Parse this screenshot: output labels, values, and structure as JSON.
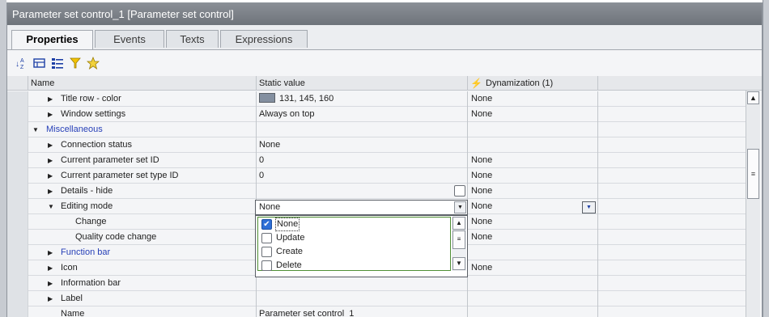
{
  "window": {
    "title": "Parameter set control_1 [Parameter set control]"
  },
  "tabs": [
    {
      "label": "Properties",
      "active": true
    },
    {
      "label": "Events",
      "active": false
    },
    {
      "label": "Texts",
      "active": false
    },
    {
      "label": "Expressions",
      "active": false
    }
  ],
  "toolbar": {
    "icons": [
      "sort-icon",
      "category-icon",
      "list-icon",
      "filter-icon",
      "favorites-icon"
    ]
  },
  "grid": {
    "headers": {
      "name": "Name",
      "static": "Static value",
      "dynamization": "Dynamization (1)"
    },
    "rows": [
      {
        "name": "Title row - color",
        "static": "131, 145, 160",
        "dyn": "None"
      },
      {
        "name": "Window settings",
        "static": "Always on top",
        "dyn": "None"
      },
      {
        "name": "Miscellaneous",
        "static": "",
        "dyn": ""
      },
      {
        "name": "Connection status",
        "static": "None",
        "dyn": ""
      },
      {
        "name": "Current parameter set ID",
        "static": "0",
        "dyn": "None"
      },
      {
        "name": "Current parameter set type ID",
        "static": "0",
        "dyn": "None"
      },
      {
        "name": "Details - hide",
        "static": "",
        "dyn": "None"
      },
      {
        "name": "Editing mode",
        "static": "None",
        "dyn": "None"
      },
      {
        "name": "Change",
        "static": "",
        "dyn": "None"
      },
      {
        "name": "Quality code change",
        "static": "",
        "dyn": "None"
      },
      {
        "name": "Function bar",
        "static": "",
        "dyn": ""
      },
      {
        "name": "Icon",
        "static": "",
        "dyn": "None"
      },
      {
        "name": "Information bar",
        "static": "",
        "dyn": ""
      },
      {
        "name": "Label",
        "static": "",
        "dyn": ""
      },
      {
        "name": "Name",
        "static": "Parameter set control_1",
        "dyn": ""
      }
    ]
  },
  "editing_mode_options": [
    {
      "label": "None",
      "checked": true
    },
    {
      "label": "Update",
      "checked": false
    },
    {
      "label": "Create",
      "checked": false
    },
    {
      "label": "Delete",
      "checked": false
    }
  ],
  "colors": {
    "title_row_color": "#838fa0",
    "accent_link": "#2740b8",
    "focus_border": "#4f8f35"
  }
}
